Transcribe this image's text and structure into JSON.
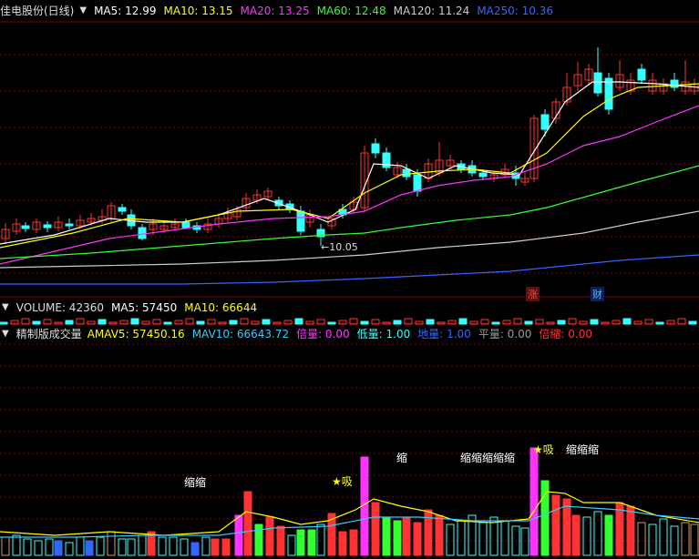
{
  "main": {
    "stock": "佳电股份(日线)",
    "indicators": [
      {
        "label": "MA5: 12.99",
        "color": "#ffffff"
      },
      {
        "label": "MA10: 13.15",
        "color": "#ffff00"
      },
      {
        "label": "MA20: 13.25",
        "color": "#ff33ff"
      },
      {
        "label": "MA60: 12.48",
        "color": "#33ff33"
      },
      {
        "label": "MA120: 11.24",
        "color": "#cccccc"
      },
      {
        "label": "MA250: 10.36",
        "color": "#3366ff"
      }
    ],
    "low_marker": "10.05",
    "tags": [
      {
        "text": "涨",
        "color": "#ff4444"
      },
      {
        "text": "财",
        "color": "#66aaff"
      }
    ]
  },
  "volume_panel": {
    "items": [
      {
        "label": "VOLUME: 42360",
        "color": "#dddddd"
      },
      {
        "label": "MA5: 57450",
        "color": "#ffffff"
      },
      {
        "label": "MA10: 66644",
        "color": "#ffff00"
      }
    ]
  },
  "indicator_panel": {
    "name": "精制版成交量",
    "items": [
      {
        "label": "AMAV5: 57450.16",
        "color": "#ffff00"
      },
      {
        "label": "MAV10: 66643.72",
        "color": "#33ccff"
      },
      {
        "label": "倍量: 0.00",
        "color": "#ff33ff"
      },
      {
        "label": "低量: 1.00",
        "color": "#33ffff"
      },
      {
        "label": "地量: 1.00",
        "color": "#3366ff"
      },
      {
        "label": "平量: 0.00",
        "color": "#999999"
      },
      {
        "label": "倍缩: 0.00",
        "color": "#ff3333"
      }
    ],
    "annotations": [
      {
        "text": "缩缩",
        "color": "#ffffff"
      },
      {
        "text": "★吸",
        "color": "#ffff00"
      },
      {
        "text": "缩",
        "color": "#ffffff"
      },
      {
        "text": "缩缩缩缩缩",
        "color": "#ffffff"
      },
      {
        "text": "★吸",
        "color": "#ffff00"
      },
      {
        "text": "缩缩缩",
        "color": "#ffffff"
      }
    ]
  },
  "colors": {
    "up": "#ff3333",
    "down": "#33ffff",
    "grid": "#8b0000",
    "bg": "#000000"
  }
}
